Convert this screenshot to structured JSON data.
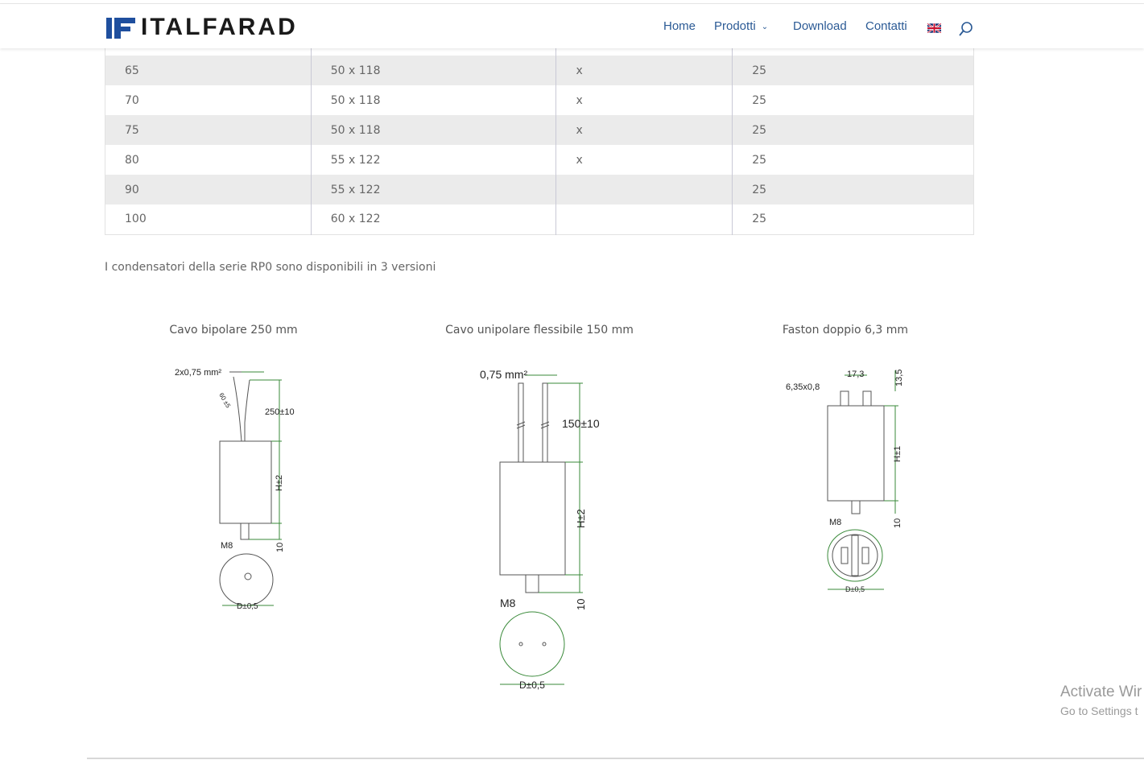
{
  "header": {
    "logo_text": "ITALFARAD",
    "nav": [
      {
        "label": "Home"
      },
      {
        "label": "Prodotti",
        "has_submenu": true
      },
      {
        "label": "Download"
      },
      {
        "label": "Contatti"
      }
    ],
    "language_flag": "uk-flag-icon",
    "search_icon": "search-icon",
    "accent_color": "#2b5a95"
  },
  "table": {
    "rows": [
      [
        "65",
        "50 x 118",
        "x",
        "25"
      ],
      [
        "70",
        "50 x 118",
        "x",
        "25"
      ],
      [
        "75",
        "50 x 118",
        "x",
        "25"
      ],
      [
        "80",
        "55 x 122",
        "x",
        "25"
      ],
      [
        "90",
        "55 x 122",
        "",
        "25"
      ],
      [
        "100",
        "60 x 122",
        "",
        "25"
      ]
    ]
  },
  "intro": "I condensatori della serie RP0 sono disponibili in 3 versioni",
  "versions": [
    {
      "title": "Cavo bipolare 250 mm",
      "labels": {
        "wire": "2x0,75 mm²",
        "length": "250±10",
        "height": "H±2",
        "bolt": "M8",
        "bolt_len": "10",
        "diameter": "D±0,5",
        "small": "60 ±5"
      }
    },
    {
      "title": "Cavo unipolare flessibile 150 mm",
      "labels": {
        "wire": "0,75 mm²",
        "length": "150±10",
        "height": "H±2",
        "bolt": "M8",
        "bolt_len": "10",
        "diameter": "D±0,5"
      }
    },
    {
      "title": "Faston doppio 6,3 mm",
      "labels": {
        "faston": "6,35x0,8",
        "spacing": "17,3",
        "top": "13,5",
        "height": "H±1",
        "bolt": "M8",
        "bolt_len": "10",
        "diameter": "D±0,5"
      }
    }
  ],
  "windows_watermark": {
    "title": "Activate Wir",
    "subtitle": "Go to Settings t"
  }
}
